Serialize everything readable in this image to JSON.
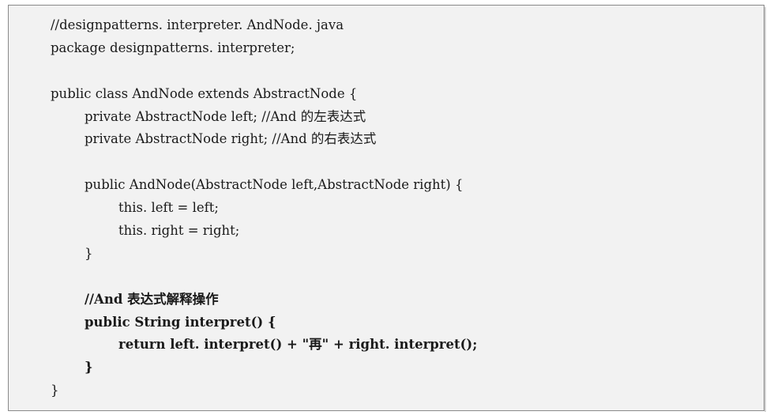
{
  "code": {
    "lines": [
      "//designpatterns. interpreter. AndNode. java",
      "package designpatterns. interpreter;",
      "",
      "public class AndNode extends AbstractNode {",
      "private AbstractNode left; //And 的左表达式",
      "private AbstractNode right; //And 的右表达式",
      "",
      "public AndNode(AbstractNode left,AbstractNode right) {",
      "this. left = left;",
      "this. right = right;",
      "}",
      "",
      "//And 表达式解释操作",
      "public String interpret() {",
      "return left. interpret() + \"再\" + right. interpret();",
      "}",
      "}"
    ]
  }
}
